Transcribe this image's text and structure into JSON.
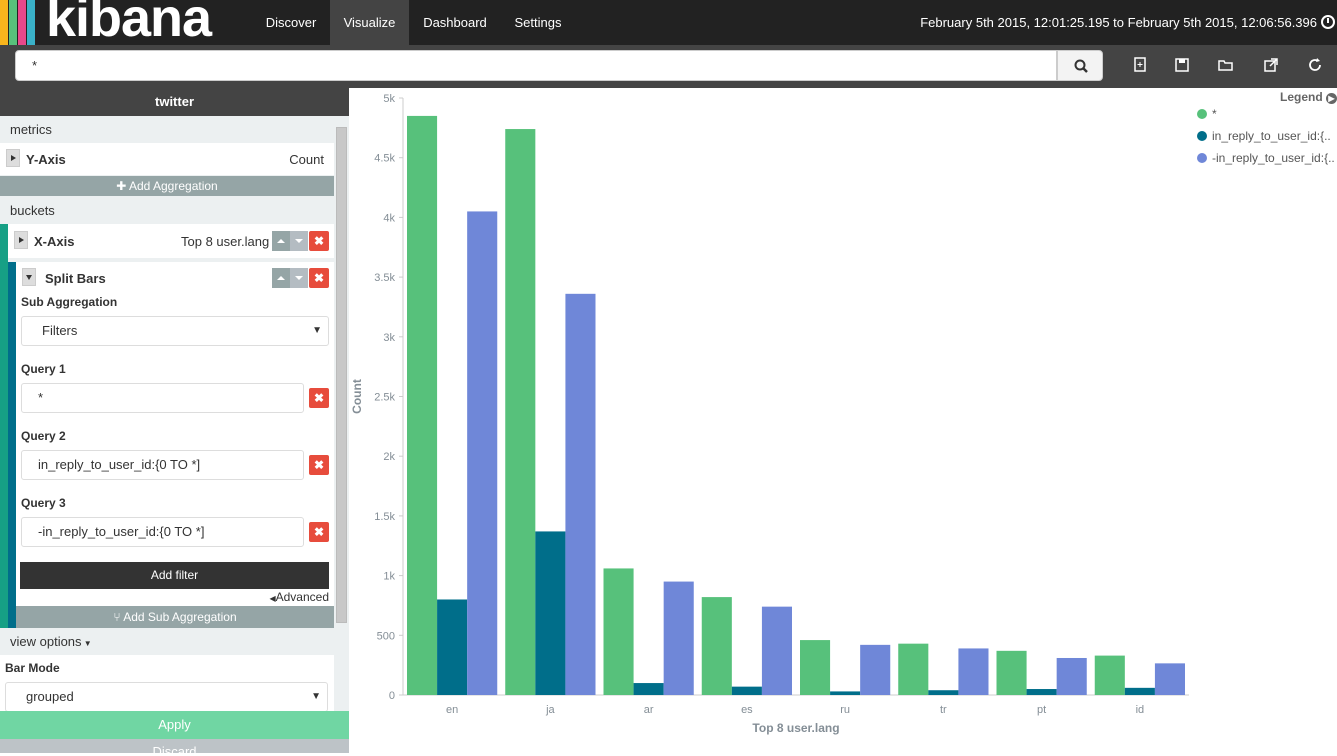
{
  "app": {
    "logo_text": "kibana",
    "logo_colors": [
      "#f8b51c",
      "#58c07b",
      "#e8488b",
      "#3ab1c8"
    ]
  },
  "nav": {
    "tabs": [
      "Discover",
      "Visualize",
      "Dashboard",
      "Settings"
    ],
    "active": "Visualize"
  },
  "time_range": "February 5th 2015, 12:01:25.195 to February 5th 2015, 12:06:56.396",
  "search": {
    "value": "*"
  },
  "toolbar_icons": [
    "new-visualization-icon",
    "save-icon",
    "open-icon",
    "share-icon",
    "refresh-icon"
  ],
  "sidebar": {
    "title": "twitter",
    "metrics_label": "metrics",
    "y_axis": {
      "label": "Y-Axis",
      "value": "Count"
    },
    "add_aggregation": "Add Aggregation",
    "buckets_label": "buckets",
    "x_axis": {
      "label": "X-Axis",
      "value": "Top 8 user.lang"
    },
    "split_bars": {
      "label": "Split Bars"
    },
    "sub_aggregation_label": "Sub Aggregation",
    "sub_aggregation_value": "Filters",
    "queries": [
      {
        "label": "Query 1",
        "value": "*"
      },
      {
        "label": "Query 2",
        "value": "in_reply_to_user_id:{0 TO *]"
      },
      {
        "label": "Query 3",
        "value": "-in_reply_to_user_id:{0 TO *]"
      }
    ],
    "add_filter": "Add filter",
    "advanced": "Advanced",
    "add_sub_aggregation": "Add Sub Aggregation",
    "view_options": "view options",
    "bar_mode_label": "Bar Mode",
    "bar_mode_value": "grouped",
    "apply": "Apply",
    "discard": "Discard"
  },
  "colors": {
    "series1": "#57c17b",
    "series2": "#006e8a",
    "series3": "#6f87d8",
    "danger": "#e74c3c",
    "active_bar": "#16a085"
  },
  "chart_data": {
    "type": "bar",
    "categories": [
      "en",
      "ja",
      "ar",
      "es",
      "ru",
      "tr",
      "pt",
      "id"
    ],
    "series": [
      {
        "name": "*",
        "values": [
          4850,
          4740,
          1060,
          820,
          460,
          430,
          370,
          330
        ]
      },
      {
        "name": "in_reply_to_user_id:{..",
        "values": [
          800,
          1370,
          100,
          70,
          30,
          40,
          50,
          60
        ]
      },
      {
        "name": "-in_reply_to_user_id:{..",
        "values": [
          4050,
          3360,
          950,
          740,
          420,
          390,
          310,
          265
        ]
      }
    ],
    "xlabel": "Top 8 user.lang",
    "ylabel": "Count",
    "ylim": [
      0,
      5000
    ],
    "yticks": [
      "0",
      "500",
      "1k",
      "1.5k",
      "2k",
      "2.5k",
      "3k",
      "3.5k",
      "4k",
      "4.5k",
      "5k"
    ],
    "legend_title": "Legend",
    "legend_position": "top-right",
    "grid": false
  }
}
